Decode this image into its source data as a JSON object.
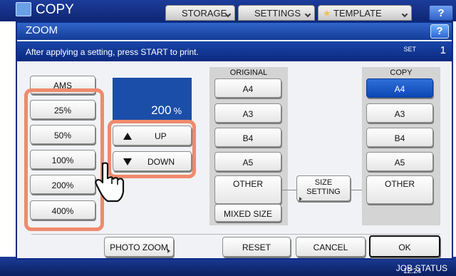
{
  "background": {
    "app_title": "COPY",
    "tabs": [
      "STORAGE",
      "SETTINGS",
      "TEMPLATE"
    ],
    "help": "?",
    "clock": "12:24",
    "job_status": "JOB STATUS"
  },
  "dialog": {
    "title": "ZOOM",
    "help": "?",
    "message": "After applying a setting, press START to print.",
    "set_label": "SET",
    "set_count": "1",
    "ams_label": "AMS",
    "presets": [
      "25%",
      "50%",
      "100%",
      "200%",
      "400%"
    ],
    "zoom_value": "200",
    "zoom_unit": "%",
    "up_label": "UP",
    "down_label": "DOWN",
    "original_header": "ORIGINAL",
    "original_sizes": [
      "A4",
      "A3",
      "B4",
      "A5",
      "OTHER",
      "MIXED SIZE"
    ],
    "size_setting": [
      "SIZE",
      "SETTING"
    ],
    "copy_header": "COPY",
    "copy_sizes": [
      "A4",
      "A3",
      "B4",
      "A5",
      "OTHER"
    ],
    "selected_copy_size": "A4",
    "photo_zoom": "PHOTO ZOOM",
    "reset": "RESET",
    "cancel": "CANCEL",
    "ok": "OK"
  },
  "colors": {
    "accent_blue": "#1b4ea8",
    "highlight": "#f08a6c"
  }
}
